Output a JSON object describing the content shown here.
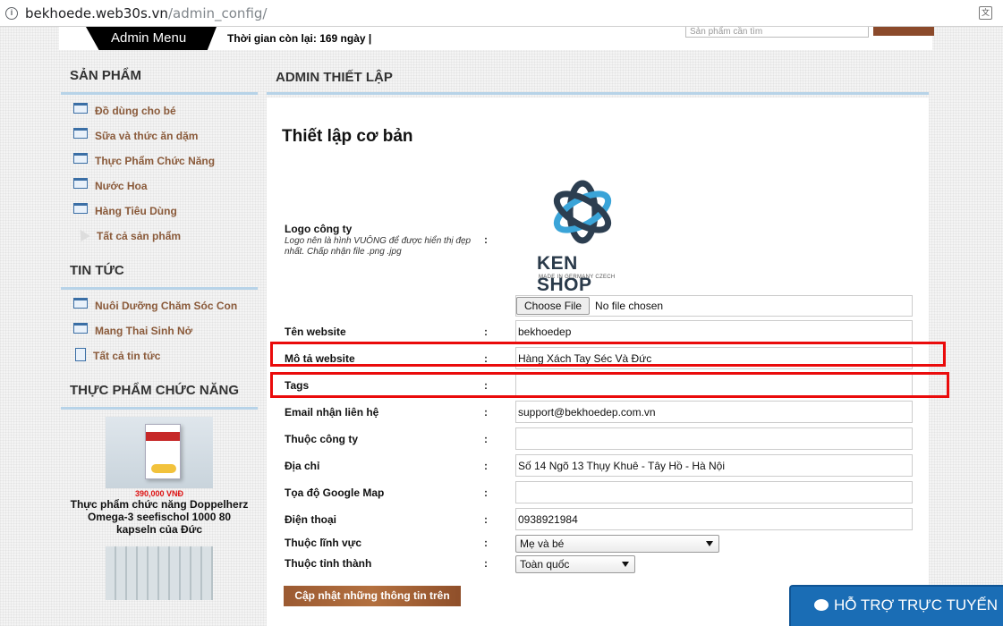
{
  "browser": {
    "url_host": "bekhoede.web30s.vn",
    "url_path": "/admin_config/"
  },
  "topbar": {
    "admin_menu": "Admin Menu",
    "time_left": "Thời gian còn lại: 169 ngày |",
    "search_placeholder": "Sản phẩm cần tìm"
  },
  "sidebar": {
    "products": {
      "title": "SẢN PHẨM",
      "items": [
        "Đồ dùng cho bé",
        "Sữa và thức ăn dặm",
        "Thực Phẩm Chức Năng",
        "Nước Hoa",
        "Hàng Tiêu Dùng",
        "Tất cả sản phẩm"
      ]
    },
    "news": {
      "title": "TIN TỨC",
      "items": [
        "Nuôi Dưỡng Chăm Sóc Con",
        "Mang Thai Sinh Nở",
        "Tất cả tin tức"
      ]
    },
    "functional_food": {
      "title": "THỰC PHẨM CHỨC NĂNG",
      "product": {
        "price": "390,000 VNĐ",
        "name": "Thực phẩm chức năng Doppelherz Omega-3 seefischol 1000 80 kapseln của Đức"
      }
    }
  },
  "main": {
    "header": "ADMIN THIẾT LẬP",
    "section_title": "Thiết lập cơ bản",
    "logo": {
      "label": "Logo công ty",
      "note": "Logo nên là hình VUÔNG để được hiển thị đẹp nhất. Chấp nhận file .png .jpg",
      "brand": "KEN SHOP",
      "brand_sub": "MADE IN GERMANY CZECH"
    },
    "file": {
      "button": "Choose File",
      "status": "No file chosen"
    },
    "fields": {
      "website_name": {
        "label": "Tên website",
        "value": "bekhoedep"
      },
      "website_desc": {
        "label": "Mô tả website",
        "value": "Hàng Xách Tay Séc Và Đức"
      },
      "tags": {
        "label": "Tags",
        "value": ""
      },
      "email": {
        "label": "Email nhận liên hệ",
        "value": "support@bekhoedep.com.vn"
      },
      "company": {
        "label": "Thuộc công ty",
        "value": ""
      },
      "address": {
        "label": "Địa chỉ",
        "value": "Số 14 Ngõ 13 Thụy Khuê - Tây Hồ - Hà Nội"
      },
      "map": {
        "label": "Tọa độ Google Map",
        "value": ""
      },
      "phone": {
        "label": "Điện thoại",
        "value": "0938921984"
      }
    },
    "selects": {
      "field": {
        "label": "Thuộc lĩnh vực",
        "value": "Mẹ và bé"
      },
      "province": {
        "label": "Thuộc tỉnh thành",
        "value": "Toàn quốc"
      }
    },
    "colon": ":",
    "submit": "Cập nhật những thông tin trên"
  },
  "support": {
    "label": "HỖ TRỢ TRỰC TUYẾN"
  },
  "colors": {
    "highlight": "#ea0b0b",
    "support_bg": "#1a6db5",
    "link_brown": "#8a5a3a",
    "section_rule": "#b7d3e8"
  }
}
